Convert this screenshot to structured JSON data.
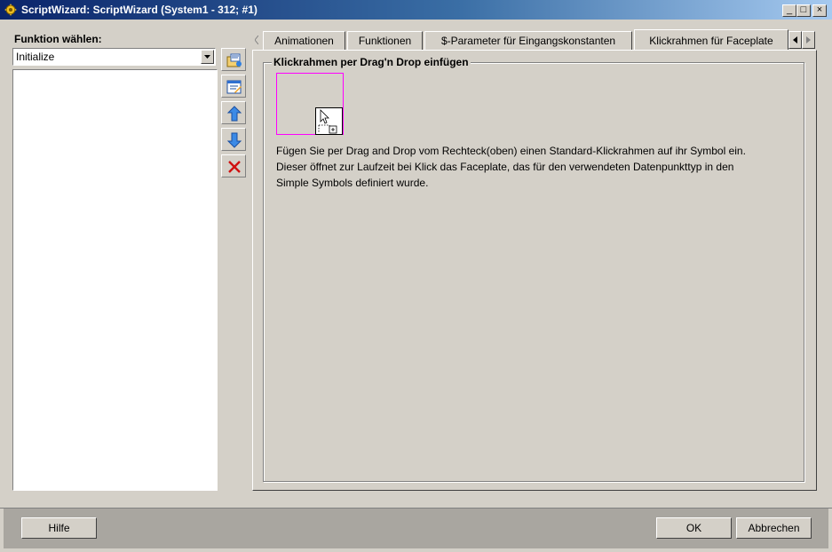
{
  "window": {
    "title": "ScriptWizard: ScriptWizard (System1 - 312; #1)",
    "minimize_glyph": "_",
    "maximize_glyph": "□",
    "close_glyph": "×"
  },
  "left_panel": {
    "label": "Funktion wählen:",
    "function_select": {
      "value": "Initialize"
    },
    "toolbar_icons": [
      "open-script-icon",
      "edit-script-icon",
      "move-up-icon",
      "move-down-icon",
      "delete-icon"
    ]
  },
  "tabs": [
    {
      "label": "Animationen",
      "active": false
    },
    {
      "label": "Funktionen",
      "active": false
    },
    {
      "label": "$-Parameter für Eingangskonstanten",
      "active": false
    },
    {
      "label": "Klickrahmen für Faceplate",
      "active": true
    }
  ],
  "content": {
    "group_title": "Klickrahmen per Drag'n Drop einfügen",
    "description_lines": [
      "Fügen Sie per Drag and Drop vom Rechteck(oben) einen Standard-Klickrahmen auf ihr Symbol ein.",
      "Dieser öffnet zur Laufzeit bei Klick das Faceplate, das für den verwendeten Datenpunkttyp in den",
      "Simple Symbols definiert wurde."
    ]
  },
  "footer": {
    "help_label": "Hilfe",
    "ok_label": "OK",
    "cancel_label": "Abbrechen"
  },
  "colors": {
    "titlebar_start": "#0a246a",
    "titlebar_end": "#a6caf0",
    "dialog_bg": "#d4d0c8",
    "drag_frame": "#ff00ff"
  }
}
